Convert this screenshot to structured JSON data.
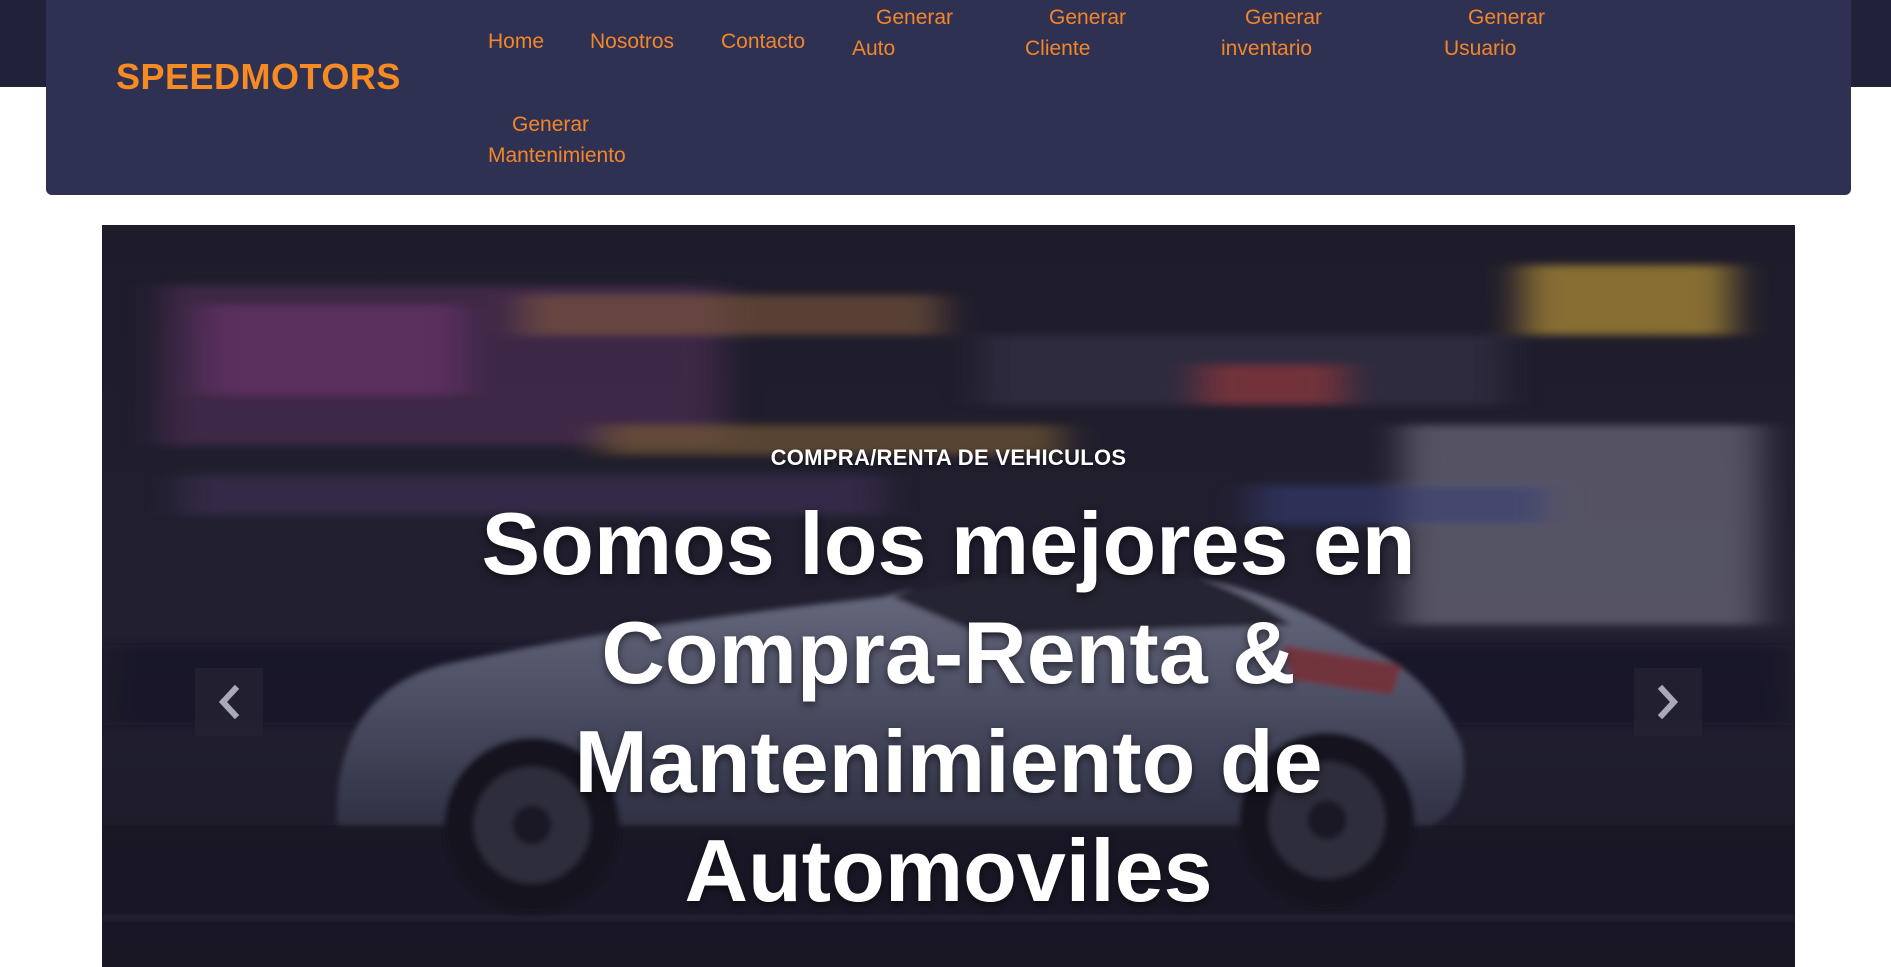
{
  "header": {
    "brand": "SPEEDMOTORS",
    "nav": [
      {
        "id": "home",
        "label": "Home"
      },
      {
        "id": "nosotros",
        "label": "Nosotros"
      },
      {
        "id": "contacto",
        "label": "Contacto"
      },
      {
        "id": "generar-auto",
        "line1": "Generar",
        "line2": "Auto"
      },
      {
        "id": "generar-cliente",
        "line1": "Generar",
        "line2": "Cliente"
      },
      {
        "id": "generar-inventario",
        "line1": "Generar",
        "line2": "inventario"
      },
      {
        "id": "generar-usuario",
        "line1": "Generar",
        "line2": "Usuario"
      },
      {
        "id": "generar-mantenimiento",
        "line1": "Generar",
        "line2": "Mantenimiento"
      }
    ]
  },
  "hero": {
    "eyebrow": "COMPRA/RENTA DE VEHICULOS",
    "title": "Somos los mejores en Compra-Renta & Mantenimiento de Automoviles",
    "prev_icon": "chevron-left-icon",
    "next_icon": "chevron-right-icon"
  },
  "colors": {
    "navbar": "#2e3152",
    "accent": "#f3852a",
    "brand": "#f68a23"
  }
}
